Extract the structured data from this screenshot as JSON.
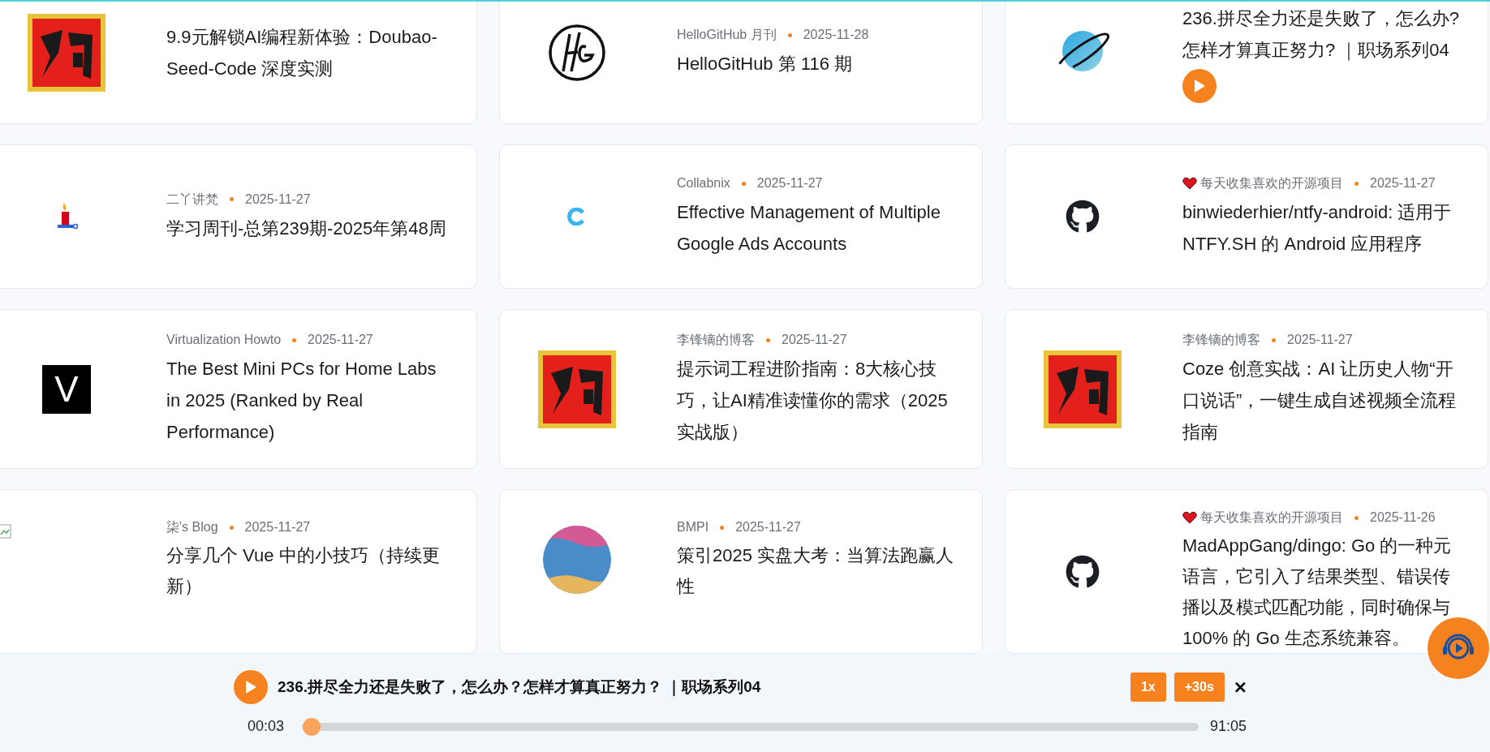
{
  "cards": [
    {
      "thumb": {
        "kind": "stamp"
      },
      "title": "9.9元解锁AI编程新体验：Doubao-Seed-Code 深度实测"
    },
    {
      "thumb": {
        "kind": "hg"
      },
      "source": "HelloGitHub 月刊",
      "date": "2025-11-28",
      "title": "HelloGitHub 第 116 期"
    },
    {
      "thumb": {
        "kind": "planet"
      },
      "title": "236.拼尽全力还是失败了，怎么办?怎样才算真正努力? ｜职场系列04",
      "play": true
    },
    {
      "thumb": {
        "kind": "candle"
      },
      "source": "二丫讲梵",
      "date": "2025-11-27",
      "title": "学习周刊-总第239期-2025年第48周"
    },
    {
      "thumb": {
        "kind": "collabnix"
      },
      "source": "Collabnix",
      "date": "2025-11-27",
      "title": "Effective Management of Multiple Google Ads Accounts"
    },
    {
      "thumb": {
        "kind": "github"
      },
      "source": "每天收集喜欢的开源项目",
      "heart": true,
      "date": "2025-11-27",
      "title": "binwiederhier/ntfy-android: 适用于 NTFY.SH 的 Android 应用程序"
    },
    {
      "thumb": {
        "kind": "letter",
        "text": "V"
      },
      "source": "Virtualization Howto",
      "date": "2025-11-27",
      "title": "The Best Mini PCs for Home Labs in 2025 (Ranked by Real Performance)"
    },
    {
      "thumb": {
        "kind": "stamp"
      },
      "source": "李锋镝的博客",
      "date": "2025-11-27",
      "title": "提示词工程进阶指南：8大核心技巧，让AI精准读懂你的需求（2025实战版）"
    },
    {
      "thumb": {
        "kind": "stamp"
      },
      "source": "李锋镝的博客",
      "date": "2025-11-27",
      "title": "Coze 创意实战：AI 让历史人物“开口说话”，一键生成自述视频全流程指南"
    },
    {
      "thumb": {
        "kind": "broken"
      },
      "source": "柒's Blog",
      "date": "2025-11-27",
      "title": "分享几个 Vue 中的小技巧（持续更新）"
    },
    {
      "thumb": {
        "kind": "bmpi"
      },
      "source": "BMPI",
      "date": "2025-11-27",
      "title": "策引2025 实盘大考：当算法跑赢人性"
    },
    {
      "thumb": {
        "kind": "github"
      },
      "source": "每天收集喜欢的开源项目",
      "heart": true,
      "date": "2025-11-26",
      "title": "MadAppGang/dingo: Go 的一种元语言，它引入了结果类型、错误传播以及模式匹配功能，同时确保与 100% 的 Go 生态系统兼容。"
    }
  ],
  "player": {
    "title": "236.拼尽全力还是失败了，怎么办？怎样才算真正努力？ ｜职场系列04",
    "speed": "1x",
    "skip": "+30s",
    "close": "×",
    "elapsed": "00:03",
    "duration": "91:05",
    "level": 0.001
  }
}
